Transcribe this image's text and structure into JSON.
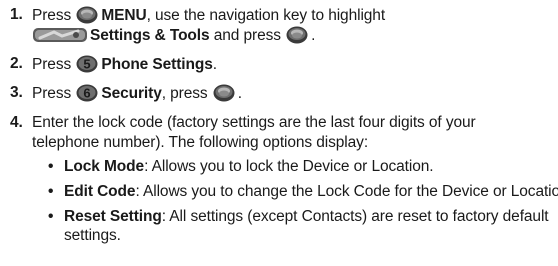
{
  "steps": [
    {
      "number": "1.",
      "line1_pre": "Press",
      "line1_bold": "MENU",
      "line1_post": ", use the navigation key to highlight",
      "line2_bold": "Settings & Tools",
      "line2_post": "and press",
      "line2_end": ".",
      "icons": [
        "ok-key-icon",
        "settings-tools-icon",
        "ok-key-icon"
      ]
    },
    {
      "number": "2.",
      "pre": "Press",
      "bold": "Phone Settings",
      "post": ".",
      "icons": [
        "key-5-icon"
      ]
    },
    {
      "number": "3.",
      "pre": "Press",
      "bold": "Security",
      "post": ", press",
      "end": ".",
      "icons": [
        "key-6-icon",
        "ok-key-icon"
      ]
    },
    {
      "number": "4.",
      "line1": "Enter the lock code (factory settings are the last four digits of your",
      "line2": "telephone number). The following options display:"
    }
  ],
  "options": [
    {
      "bullet": "•",
      "term": "Lock Mode",
      "desc": ": Allows you to lock the Device or Location."
    },
    {
      "bullet": "•",
      "term": "Edit Code",
      "desc": ": Allows you to change the Lock Code for the Device or Location."
    },
    {
      "bullet": "•",
      "term": "Reset Setting",
      "desc": ": All settings (except Contacts) are reset to factory default",
      "desc_line2": "settings."
    }
  ],
  "key_labels": {
    "key5": "5",
    "key6": "6"
  },
  "colors": {
    "text": "#1a1a1a",
    "key_dark": "#3a3a3a",
    "key_mid": "#6e6e6e",
    "key_light": "#b8b8b8"
  }
}
